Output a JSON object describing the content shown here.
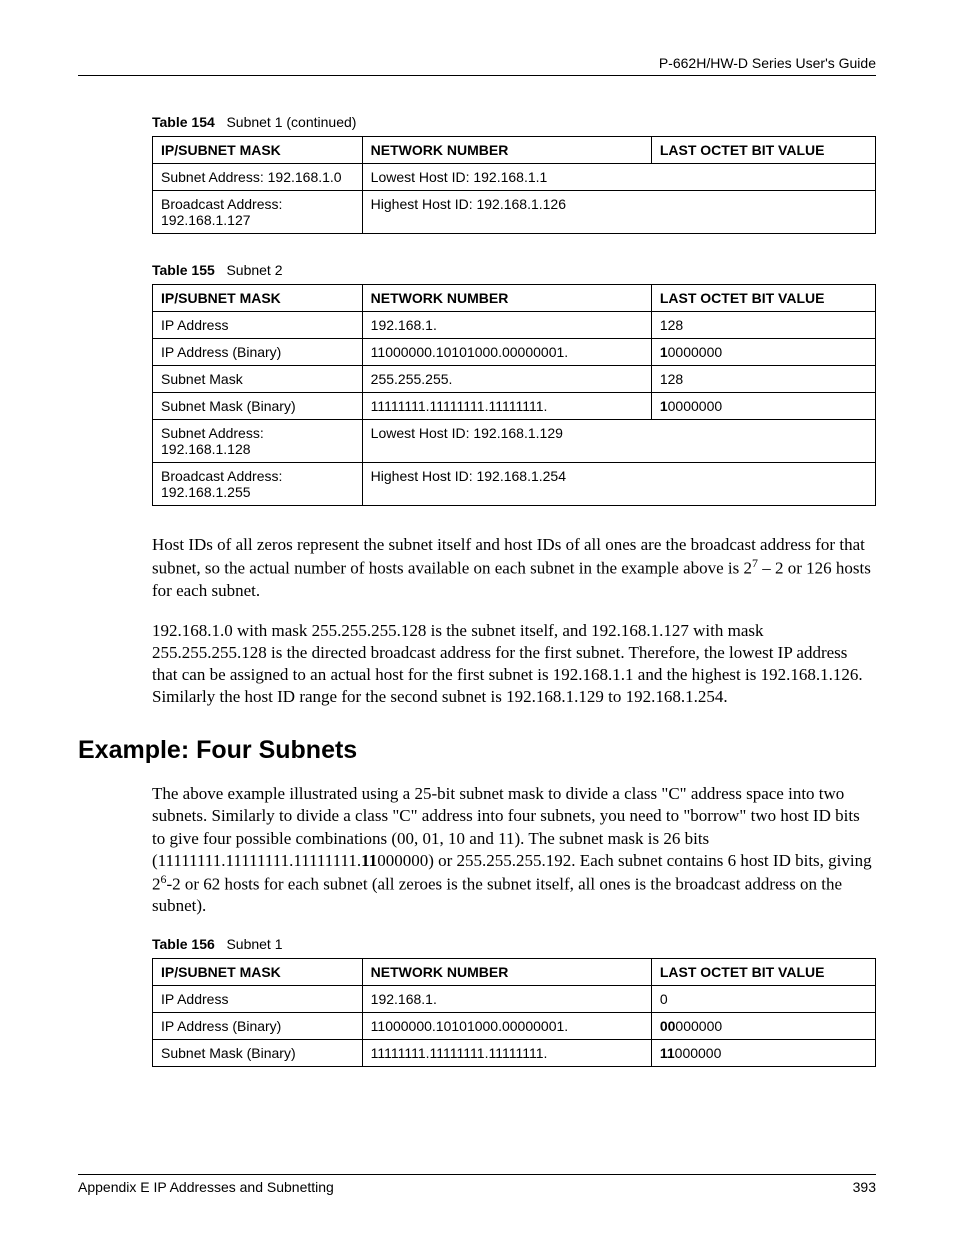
{
  "header": {
    "guide_title": "P-662H/HW-D Series User's Guide"
  },
  "footer": {
    "appendix": "Appendix E IP Addresses and Subnetting",
    "page": "393"
  },
  "table154": {
    "caption_num": "Table 154",
    "caption_title": "Subnet 1 (continued)",
    "head": {
      "c1": "IP/SUBNET MASK",
      "c2": "NETWORK NUMBER",
      "c3": "LAST OCTET BIT VALUE"
    },
    "rows": [
      {
        "c1": "Subnet Address: 192.168.1.0",
        "c2": "Lowest Host ID: 192.168.1.1",
        "span": true
      },
      {
        "c1": "Broadcast Address: 192.168.1.127",
        "c2": "Highest Host ID: 192.168.1.126",
        "span": true
      }
    ]
  },
  "table155": {
    "caption_num": "Table 155",
    "caption_title": "Subnet 2",
    "head": {
      "c1": "IP/SUBNET MASK",
      "c2": "NETWORK NUMBER",
      "c3": "LAST OCTET BIT VALUE"
    },
    "rows": [
      {
        "c1": "IP Address",
        "c2": "192.168.1.",
        "c3": "128"
      },
      {
        "c1": "IP Address (Binary)",
        "c2": "11000000.10101000.00000001.",
        "c3_bold": "1",
        "c3_rest": "0000000"
      },
      {
        "c1": "Subnet Mask",
        "c2": "255.255.255.",
        "c3": "128"
      },
      {
        "c1": "Subnet Mask (Binary)",
        "c2": "11111111.11111111.11111111.",
        "c3_bold": "1",
        "c3_rest": "0000000"
      },
      {
        "c1": "Subnet Address: 192.168.1.128",
        "c2": "Lowest Host ID: 192.168.1.129",
        "span": true
      },
      {
        "c1": "Broadcast Address: 192.168.1.255",
        "c2": "Highest Host ID: 192.168.1.254",
        "span": true
      }
    ]
  },
  "para1": {
    "pre": "Host IDs of all zeros represent the subnet itself and host IDs of all ones are the broadcast address for that subnet, so the actual number of hosts available on each subnet in the example above is 2",
    "sup": "7",
    "post": " – 2 or 126 hosts for each subnet."
  },
  "para2": "192.168.1.0 with mask 255.255.255.128 is the subnet itself, and 192.168.1.127 with mask 255.255.255.128 is the directed broadcast address for the first subnet. Therefore, the lowest IP address that can be assigned to an actual host for the first subnet is 192.168.1.1 and the highest is 192.168.1.126. Similarly the host ID range for the second subnet is 192.168.1.129 to 192.168.1.254.",
  "section_heading": "Example: Four Subnets",
  "para3": {
    "pre": "The above example illustrated using a 25-bit subnet mask to divide a class \"C\" address space into two subnets. Similarly to divide a class \"C\" address into four subnets, you need to \"borrow\" two host ID bits to give four possible combinations (00, 01, 10 and 11). The subnet mask is 26 bits (11111111.11111111.11111111.",
    "bold": "11",
    "mid": "000000) or 255.255.255.192. Each subnet contains 6 host ID bits, giving 2",
    "sup": "6",
    "post": "-2 or 62 hosts for each subnet (all zeroes is the subnet itself, all ones is the broadcast address on the subnet)."
  },
  "table156": {
    "caption_num": "Table 156",
    "caption_title": "Subnet 1",
    "head": {
      "c1": "IP/SUBNET MASK",
      "c2": "NETWORK NUMBER",
      "c3": "LAST OCTET BIT VALUE"
    },
    "rows": [
      {
        "c1": "IP Address",
        "c2": "192.168.1.",
        "c3": "0"
      },
      {
        "c1": "IP Address (Binary)",
        "c2": "11000000.10101000.00000001.",
        "c3_bold": "00",
        "c3_rest": "000000"
      },
      {
        "c1": "Subnet Mask (Binary)",
        "c2": "11111111.11111111.11111111.",
        "c3_bold": "11",
        "c3_rest": "000000"
      }
    ]
  }
}
